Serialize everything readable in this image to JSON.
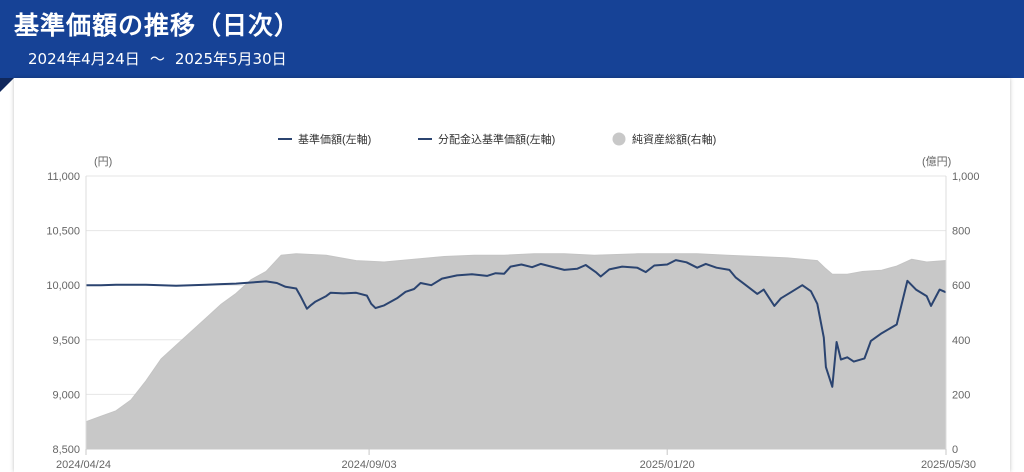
{
  "header": {
    "title": "基準価額の推移（日次）",
    "period_start": "2024年4月24日",
    "period_sep": "～",
    "period_end": "2025年5月30日"
  },
  "colors": {
    "header_bg": "#164296",
    "line": "#2b4470",
    "area": "#d0d0d0"
  },
  "chart_data": {
    "type": "line",
    "title": "",
    "legend": {
      "placement": "top-center",
      "items": [
        {
          "label": "基準価額(左軸)",
          "kind": "line",
          "color": "#2b4470"
        },
        {
          "label": "分配金込基準価額(左軸)",
          "kind": "line",
          "color": "#2b4470"
        },
        {
          "label": "純資産総額(右軸)",
          "kind": "area",
          "color": "#c8c8c8"
        }
      ]
    },
    "y_left": {
      "unit": "(円)",
      "min": 8500,
      "max": 11000,
      "ticks": [
        "8,500",
        "9,000",
        "9,500",
        "10,000",
        "10,500",
        "11,000"
      ]
    },
    "y_right": {
      "unit": "(億円)",
      "min": 0,
      "max": 1000,
      "ticks": [
        "0",
        "200",
        "400",
        "600",
        "800",
        "1,000"
      ]
    },
    "x": {
      "start": "2024-04-24",
      "end": "2025-05-30",
      "tick_labels": [
        "2024/04/24",
        "2024/09/03",
        "2025/01/20",
        "2025/05/30"
      ],
      "tick_dates": [
        "2024-04-24",
        "2024-09-03",
        "2025-01-20",
        "2025-05-30"
      ]
    },
    "grid": "horizontal",
    "series": [
      {
        "name": "基準価額(左軸)",
        "axis": "left",
        "points": [
          [
            "2024-04-24",
            10000
          ],
          [
            "2024-05-01",
            10000
          ],
          [
            "2024-05-08",
            10005
          ],
          [
            "2024-05-15",
            10005
          ],
          [
            "2024-05-22",
            10005
          ],
          [
            "2024-05-29",
            10000
          ],
          [
            "2024-06-05",
            9995
          ],
          [
            "2024-06-12",
            10000
          ],
          [
            "2024-06-19",
            10005
          ],
          [
            "2024-06-26",
            10010
          ],
          [
            "2024-07-03",
            10015
          ],
          [
            "2024-07-10",
            10025
          ],
          [
            "2024-07-17",
            10035
          ],
          [
            "2024-07-22",
            10020
          ],
          [
            "2024-07-26",
            9985
          ],
          [
            "2024-07-31",
            9970
          ],
          [
            "2024-08-02",
            9900
          ],
          [
            "2024-08-05",
            9785
          ],
          [
            "2024-08-07",
            9820
          ],
          [
            "2024-08-09",
            9850
          ],
          [
            "2024-08-14",
            9900
          ],
          [
            "2024-08-16",
            9930
          ],
          [
            "2024-08-22",
            9925
          ],
          [
            "2024-08-28",
            9930
          ],
          [
            "2024-09-02",
            9905
          ],
          [
            "2024-09-04",
            9830
          ],
          [
            "2024-09-06",
            9790
          ],
          [
            "2024-09-10",
            9815
          ],
          [
            "2024-09-16",
            9880
          ],
          [
            "2024-09-20",
            9940
          ],
          [
            "2024-09-24",
            9965
          ],
          [
            "2024-09-27",
            10020
          ],
          [
            "2024-10-02",
            10000
          ],
          [
            "2024-10-07",
            10060
          ],
          [
            "2024-10-14",
            10090
          ],
          [
            "2024-10-21",
            10100
          ],
          [
            "2024-10-28",
            10085
          ],
          [
            "2024-11-01",
            10110
          ],
          [
            "2024-11-05",
            10105
          ],
          [
            "2024-11-08",
            10170
          ],
          [
            "2024-11-13",
            10190
          ],
          [
            "2024-11-18",
            10165
          ],
          [
            "2024-11-22",
            10195
          ],
          [
            "2024-11-27",
            10170
          ],
          [
            "2024-12-03",
            10140
          ],
          [
            "2024-12-09",
            10150
          ],
          [
            "2024-12-13",
            10185
          ],
          [
            "2024-12-18",
            10115
          ],
          [
            "2024-12-20",
            10080
          ],
          [
            "2024-12-24",
            10145
          ],
          [
            "2024-12-30",
            10170
          ],
          [
            "2025-01-06",
            10160
          ],
          [
            "2025-01-10",
            10120
          ],
          [
            "2025-01-14",
            10180
          ],
          [
            "2025-01-20",
            10190
          ],
          [
            "2025-01-24",
            10230
          ],
          [
            "2025-01-29",
            10210
          ],
          [
            "2025-02-03",
            10160
          ],
          [
            "2025-02-07",
            10195
          ],
          [
            "2025-02-12",
            10160
          ],
          [
            "2025-02-18",
            10140
          ],
          [
            "2025-02-21",
            10070
          ],
          [
            "2025-02-25",
            10010
          ],
          [
            "2025-03-03",
            9920
          ],
          [
            "2025-03-06",
            9960
          ],
          [
            "2025-03-11",
            9810
          ],
          [
            "2025-03-14",
            9880
          ],
          [
            "2025-03-19",
            9940
          ],
          [
            "2025-03-24",
            10000
          ],
          [
            "2025-03-28",
            9945
          ],
          [
            "2025-03-31",
            9830
          ],
          [
            "2025-04-03",
            9520
          ],
          [
            "2025-04-04",
            9250
          ],
          [
            "2025-04-07",
            9070
          ],
          [
            "2025-04-09",
            9480
          ],
          [
            "2025-04-11",
            9320
          ],
          [
            "2025-04-14",
            9340
          ],
          [
            "2025-04-17",
            9300
          ],
          [
            "2025-04-22",
            9330
          ],
          [
            "2025-04-25",
            9490
          ],
          [
            "2025-04-30",
            9560
          ],
          [
            "2025-05-07",
            9640
          ],
          [
            "2025-05-12",
            10040
          ],
          [
            "2025-05-16",
            9960
          ],
          [
            "2025-05-21",
            9900
          ],
          [
            "2025-05-23",
            9810
          ],
          [
            "2025-05-27",
            9960
          ],
          [
            "2025-05-30",
            9935
          ]
        ]
      },
      {
        "name": "純資産総額(右軸)",
        "axis": "right",
        "points": [
          [
            "2024-04-24",
            100
          ],
          [
            "2024-05-01",
            120
          ],
          [
            "2024-05-08",
            140
          ],
          [
            "2024-05-15",
            180
          ],
          [
            "2024-05-22",
            250
          ],
          [
            "2024-05-29",
            330
          ],
          [
            "2024-06-05",
            380
          ],
          [
            "2024-06-12",
            430
          ],
          [
            "2024-06-19",
            480
          ],
          [
            "2024-06-26",
            530
          ],
          [
            "2024-07-03",
            570
          ],
          [
            "2024-07-10",
            620
          ],
          [
            "2024-07-17",
            650
          ],
          [
            "2024-07-24",
            710
          ],
          [
            "2024-07-31",
            715
          ],
          [
            "2024-08-14",
            710
          ],
          [
            "2024-08-28",
            690
          ],
          [
            "2024-09-10",
            685
          ],
          [
            "2024-09-24",
            695
          ],
          [
            "2024-10-08",
            705
          ],
          [
            "2024-10-22",
            710
          ],
          [
            "2024-11-05",
            710
          ],
          [
            "2024-11-19",
            715
          ],
          [
            "2024-12-03",
            715
          ],
          [
            "2024-12-17",
            710
          ],
          [
            "2025-01-06",
            715
          ],
          [
            "2025-01-20",
            715
          ],
          [
            "2025-02-03",
            715
          ],
          [
            "2025-02-17",
            710
          ],
          [
            "2025-03-03",
            705
          ],
          [
            "2025-03-17",
            700
          ],
          [
            "2025-03-31",
            690
          ],
          [
            "2025-04-04",
            660
          ],
          [
            "2025-04-07",
            640
          ],
          [
            "2025-04-14",
            640
          ],
          [
            "2025-04-21",
            650
          ],
          [
            "2025-04-30",
            655
          ],
          [
            "2025-05-07",
            670
          ],
          [
            "2025-05-14",
            695
          ],
          [
            "2025-05-21",
            685
          ],
          [
            "2025-05-30",
            690
          ]
        ]
      }
    ]
  }
}
